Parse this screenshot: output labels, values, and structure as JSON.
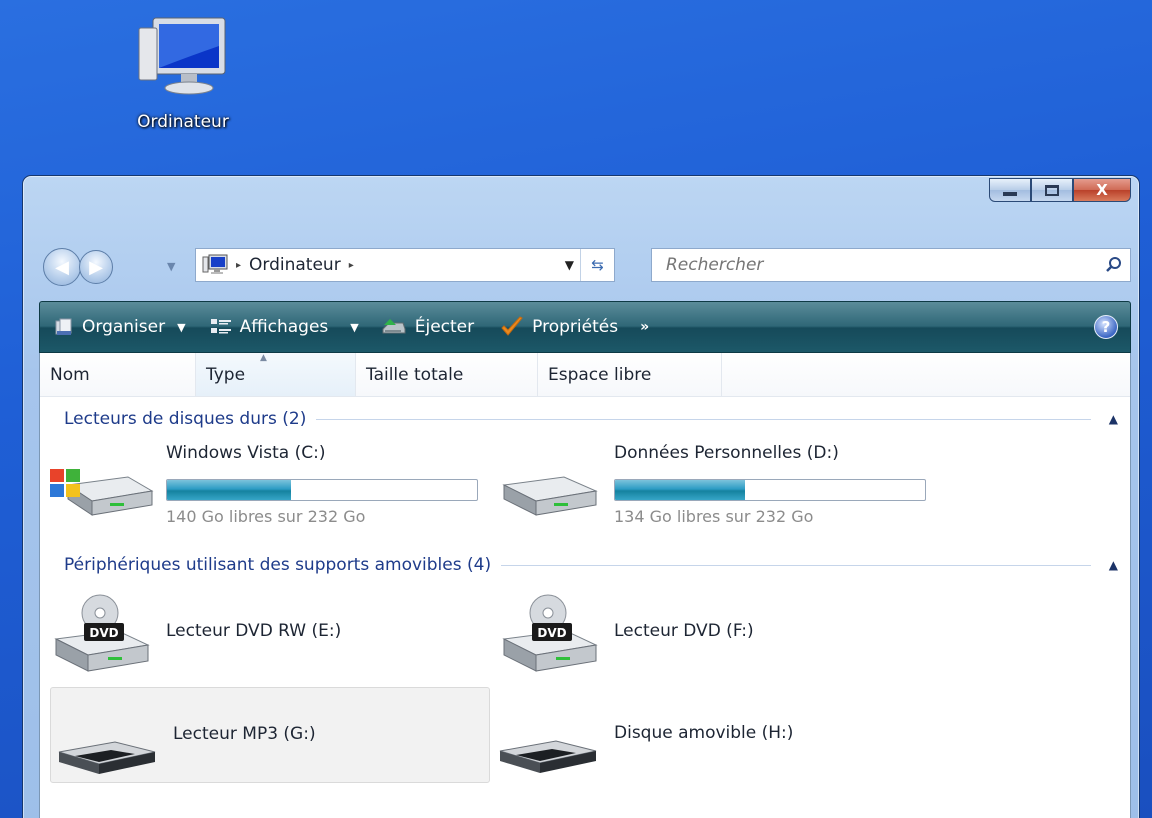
{
  "desktop": {
    "icon_label": "Ordinateur"
  },
  "window": {
    "caption": {
      "minimize_icon": "minimize-icon",
      "maximize_icon": "maximize-icon",
      "close_label": "X"
    },
    "nav": {
      "back_icon": "back-arrow-icon",
      "forward_icon": "forward-arrow-icon"
    },
    "address": {
      "crumb": "Ordinateur",
      "separator": "▸"
    },
    "search": {
      "placeholder": "Rechercher"
    },
    "toolbar": {
      "organize": "Organiser",
      "views": "Affichages",
      "eject": "Éjecter",
      "properties": "Propriétés",
      "more": "»",
      "help": "?"
    },
    "columns": [
      "Nom",
      "Type",
      "Taille totale",
      "Espace libre"
    ],
    "groups": [
      {
        "title": "Lecteurs de disques durs (2)",
        "items": [
          {
            "name": "Windows Vista (C:)",
            "free_text": "140 Go libres sur 232 Go",
            "used_fraction": 0.4,
            "icon": "hard-drive-windows-icon"
          },
          {
            "name": "Données Personnelles (D:)",
            "free_text": "134 Go libres sur 232 Go",
            "used_fraction": 0.42,
            "icon": "hard-drive-icon"
          }
        ]
      },
      {
        "title": "Périphériques utilisant des supports amovibles (4)",
        "items": [
          {
            "name": "Lecteur DVD RW (E:)",
            "icon": "dvd-drive-icon",
            "dvd_badge": "DVD"
          },
          {
            "name": "Lecteur DVD (F:)",
            "icon": "dvd-drive-icon",
            "dvd_badge": "DVD"
          },
          {
            "name": "Lecteur MP3 (G:)",
            "icon": "removable-drive-icon"
          },
          {
            "name": "Disque amovible (H:)",
            "icon": "removable-drive-icon"
          }
        ]
      }
    ]
  },
  "colors": {
    "desktop": "#1f5fd6",
    "toolbar": "#1c5868",
    "group_text": "#1e3b8a",
    "bar_fill": "#2d9cc4"
  }
}
